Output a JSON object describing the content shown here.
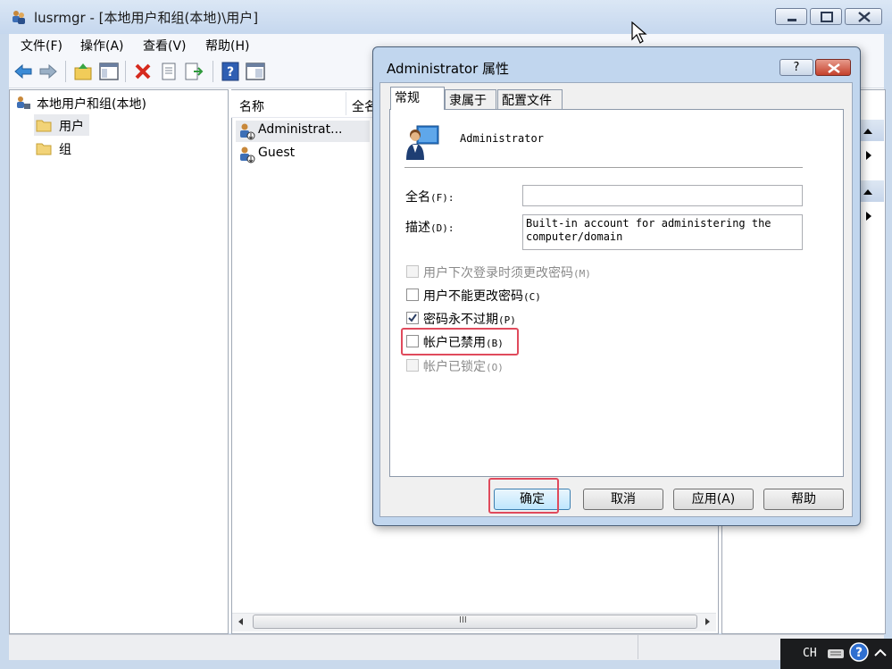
{
  "window": {
    "title": "lusrmgr - [本地用户和组(本地)\\用户]"
  },
  "menubar": {
    "items": [
      "文件(F)",
      "操作(A)",
      "查看(V)",
      "帮助(H)"
    ]
  },
  "tree": {
    "root": "本地用户和组(本地)",
    "children": [
      "用户",
      "组"
    ]
  },
  "list": {
    "columns": [
      "名称",
      "全名"
    ],
    "rows": [
      "Administrat...",
      "Guest"
    ]
  },
  "hscroll": {
    "grip": "III"
  },
  "tray": {
    "lang": "CH"
  },
  "dialog": {
    "title": "Administrator 属性",
    "help_glyph": "?",
    "tabs": [
      "常规",
      "隶属于",
      "配置文件"
    ],
    "username": "Administrator",
    "fullname_label": "全名",
    "fullname_key": "(F):",
    "fullname_value": "",
    "desc_label": "描述",
    "desc_key": "(D):",
    "desc_value": "Built-in account for administering the computer/domain",
    "checkboxes": [
      {
        "label": "用户下次登录时须更改密码",
        "key": "(M)",
        "checked": false,
        "enabled": false
      },
      {
        "label": "用户不能更改密码",
        "key": "(C)",
        "checked": false,
        "enabled": true
      },
      {
        "label": "密码永不过期",
        "key": "(P)",
        "checked": true,
        "enabled": true
      },
      {
        "label": "帐户已禁用",
        "key": "(B)",
        "checked": false,
        "enabled": true
      },
      {
        "label": "帐户已锁定",
        "key": "(O)",
        "checked": false,
        "enabled": false
      }
    ],
    "buttons": {
      "ok": "确定",
      "cancel": "取消",
      "apply": "应用(A)",
      "help": "帮助"
    }
  },
  "colors": {
    "highlight": "#e04a5c",
    "title_bar": "#c5d7ee",
    "close_red": "#c5412c"
  }
}
